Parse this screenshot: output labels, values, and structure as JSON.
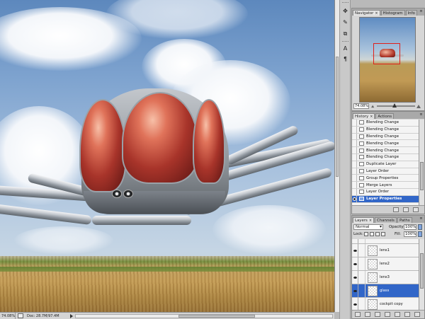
{
  "status_bar": {
    "zoom": "74.08%",
    "doc": "Doc: 28.7M/97.4M"
  },
  "tools": {
    "items": [
      "move-tool",
      "eyedropper-tool",
      "clone-tool",
      "type-tool",
      "paragraph-tool"
    ]
  },
  "navigator": {
    "tabs": [
      {
        "label": "Navigator",
        "active": true,
        "closable": true
      },
      {
        "label": "Histogram",
        "active": false
      },
      {
        "label": "Info",
        "active": false
      }
    ],
    "zoom": "74.08%"
  },
  "history": {
    "tabs": [
      {
        "label": "History",
        "active": true,
        "closable": true
      },
      {
        "label": "Actions",
        "active": false
      }
    ],
    "items": [
      {
        "label": "Blending Change",
        "selected": false
      },
      {
        "label": "Blending Change",
        "selected": false
      },
      {
        "label": "Blending Change",
        "selected": false
      },
      {
        "label": "Blending Change",
        "selected": false
      },
      {
        "label": "Blending Change",
        "selected": false
      },
      {
        "label": "Blending Change",
        "selected": false
      },
      {
        "label": "Duplicate Layer",
        "selected": false
      },
      {
        "label": "Layer Order",
        "selected": false
      },
      {
        "label": "Group Properties",
        "selected": false
      },
      {
        "label": "Merge Layers",
        "selected": false
      },
      {
        "label": "Layer Order",
        "selected": false
      },
      {
        "label": "Layer Properties",
        "selected": true
      }
    ]
  },
  "layers": {
    "tabs": [
      {
        "label": "Layers",
        "active": true,
        "closable": true
      },
      {
        "label": "Channels",
        "active": false
      },
      {
        "label": "Paths",
        "active": false
      }
    ],
    "blend_mode": "Normal",
    "opacity_label": "Opacity:",
    "opacity": "100%",
    "lock_label": "Lock:",
    "fill_label": "Fill:",
    "fill": "100%",
    "items": [
      {
        "label": "lens1",
        "selected": false
      },
      {
        "label": "lens2",
        "selected": false
      },
      {
        "label": "lens3",
        "selected": false
      },
      {
        "label": "glass",
        "selected": true
      },
      {
        "label": "cockpit copy",
        "selected": false
      }
    ]
  },
  "colors": {
    "selection": "#3166c8",
    "navigator_view_box": "#e0201b"
  }
}
